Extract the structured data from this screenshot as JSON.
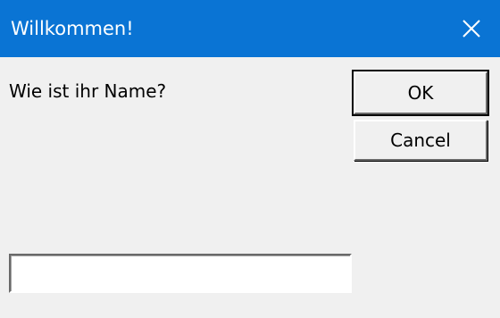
{
  "window": {
    "title": "Willkommen!",
    "titlebar_color": "#0a74d4",
    "close_icon": "close-icon"
  },
  "dialog": {
    "prompt": "Wie ist ihr Name?",
    "ok_label": "OK",
    "cancel_label": "Cancel",
    "name_input": {
      "value": "",
      "placeholder": ""
    }
  }
}
